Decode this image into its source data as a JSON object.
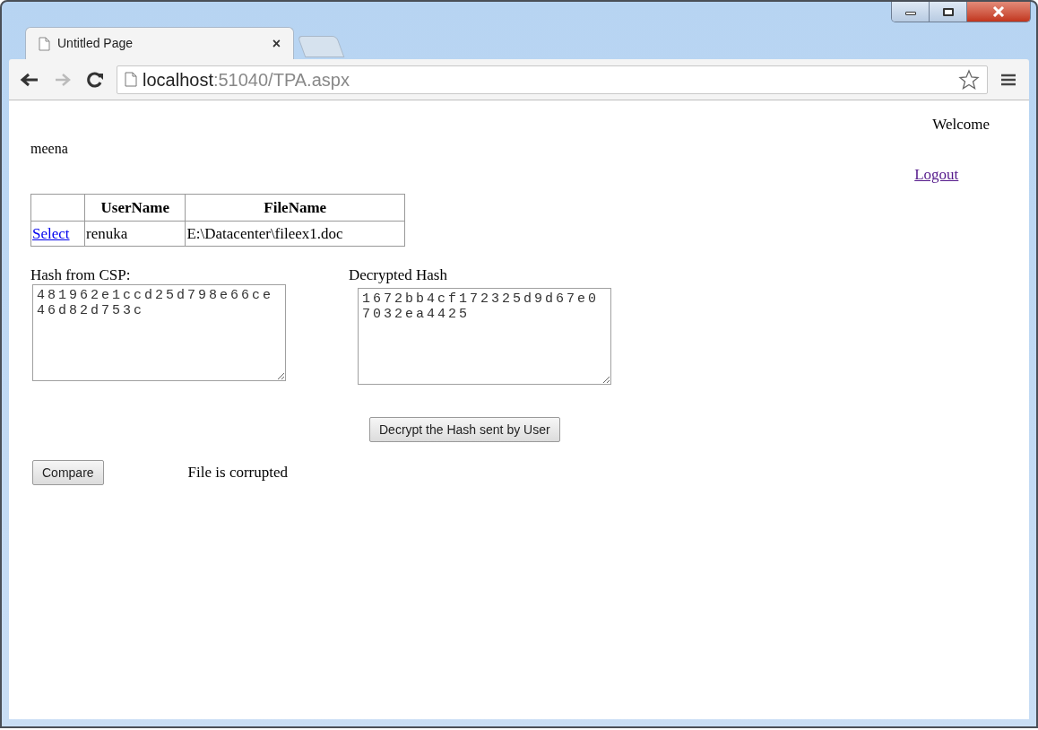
{
  "tabs": [
    {
      "title": "Untitled Page",
      "close": "×",
      "selected": true
    }
  ],
  "address": {
    "host": "localhost",
    "path": ":51040/TPA.aspx"
  },
  "page": {
    "welcome": "Welcome",
    "user": "meena",
    "logout": "Logout",
    "table": {
      "columns": [
        "UserName",
        "FileName"
      ],
      "rows": [
        {
          "action": "Select",
          "user": "renuka",
          "file": "E:\\Datacenter\\fileex1.doc"
        }
      ]
    },
    "hash_from_csp": {
      "label": "Hash from CSP:",
      "value": "481962e1ccd25d798e66ce46d82d753c"
    },
    "decrypted_hash": {
      "label": "Decrypted Hash",
      "value": "1672bb4cf172325d9d67e07032ea4425"
    },
    "decrypt_button": "Decrypt the Hash sent by User",
    "compare_button": "Compare",
    "result": "File is corrupted"
  }
}
